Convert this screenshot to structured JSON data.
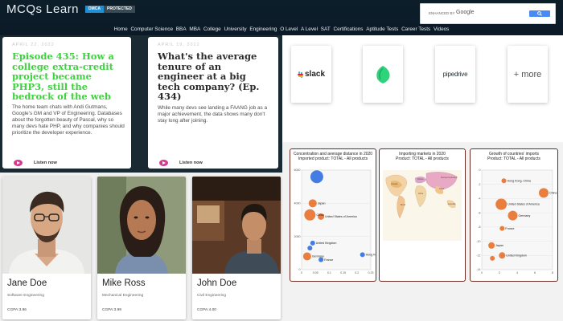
{
  "header": {
    "logo": "MCQs Learn",
    "dmca_label": "DMCA",
    "protected_label": "PROTECTED",
    "search_label": "ENHANCED BY",
    "search_brand": "Google",
    "nav": [
      "Home",
      "Computer Science",
      "BBA",
      "MBA",
      "College",
      "University",
      "Engineering",
      "O Level",
      "A Level",
      "SAT",
      "Certifications",
      "Aptitude Tests",
      "Career Tests",
      "Videos"
    ]
  },
  "podcast": {
    "episodes": [
      {
        "date": "APRIL 22, 2022",
        "title": "Episode 435: How a college extra-credit project became PHP3, still the bedrock of the web",
        "description": "The home team chats with Andi Gutmans, Google's GM and VP of Engineering. Databases about the forgotten beauty of Pascal, why so many devs hate PHP, and why companies should prioritize the developer experience.",
        "listen": "Listen now",
        "accent": "#3fd23f"
      },
      {
        "date": "APRIL 19, 2022",
        "title": "What's the average tenure of an engineer at a big tech company? (Ep. 434)",
        "description": "While many devs see landing a FAANG job as a major achievement, the data shows many don't stay long after joining.",
        "listen": "Listen now",
        "accent": "#2b2b2b"
      }
    ]
  },
  "integrations": {
    "slack": "slack",
    "pipedrive": "pipedrive",
    "more": "+ more"
  },
  "profiles": [
    {
      "name": "Jane Doe",
      "role": "Software Engineering",
      "cgpa": "CGPA:3.86"
    },
    {
      "name": "Mike Ross",
      "role": "Mechanical Engineering",
      "cgpa": "CGPA:3.99"
    },
    {
      "name": "John Doe",
      "role": "Civil Engineering",
      "cgpa": "CGPA:4.00"
    }
  ],
  "chart_data": [
    {
      "type": "scatter",
      "title": "Concentration and average distance in 2020",
      "subtitle": "Imported product: TOTAL - All products",
      "xlim": [
        0,
        0.25
      ],
      "ylim": [
        0,
        6000
      ],
      "xticks": [
        "0",
        "0.05",
        "0.1",
        "0.15",
        "0.2",
        "0.25"
      ],
      "yticks": [
        "0",
        "2000",
        "4000",
        "6000"
      ],
      "points": [
        {
          "name": "",
          "x": 0.055,
          "y": 5600,
          "size": 8,
          "color": "#2f6fe0"
        },
        {
          "name": "Japan",
          "x": 0.04,
          "y": 4000,
          "size": 5,
          "color": "#e8702a"
        },
        {
          "name": "United States of America",
          "x": 0.07,
          "y": 3200,
          "size": 4,
          "color": "#e8702a"
        },
        {
          "name": "China",
          "x": 0.03,
          "y": 3300,
          "size": 7,
          "color": "#e8702a"
        },
        {
          "name": "United Kingdom",
          "x": 0.04,
          "y": 1600,
          "size": 3,
          "color": "#2f6fe0"
        },
        {
          "name": "Germany",
          "x": 0.02,
          "y": 800,
          "size": 5,
          "color": "#e8702a"
        },
        {
          "name": "",
          "x": 0.03,
          "y": 1300,
          "size": 3,
          "color": "#2f6fe0"
        },
        {
          "name": "Hong Kong, China",
          "x": 0.22,
          "y": 900,
          "size": 3,
          "color": "#2f6fe0"
        },
        {
          "name": "France",
          "x": 0.07,
          "y": 600,
          "size": 3,
          "color": "#2f6fe0"
        }
      ]
    },
    {
      "type": "map",
      "title": "Importing markets in 2020",
      "subtitle": "Product: TOTAL - All products"
    },
    {
      "type": "scatter",
      "title": "Growth of countries' imports",
      "subtitle": "Product: TOTAL - All products",
      "xlim": [
        0,
        8
      ],
      "ylim": [
        -14,
        0
      ],
      "xticks": [
        "0",
        "2",
        "4",
        "6",
        "8"
      ],
      "yticks": [
        "0",
        "-2",
        "-4",
        "-6",
        "-8",
        "-10",
        "-12",
        "-14"
      ],
      "points": [
        {
          "name": "Hong Kong, China",
          "x": 2.5,
          "y": -1.5,
          "size": 3,
          "color": "#e8702a"
        },
        {
          "name": "United States of America",
          "x": 2.2,
          "y": -4.8,
          "size": 7,
          "color": "#e8702a"
        },
        {
          "name": "Germany",
          "x": 3.5,
          "y": -6.4,
          "size": 6,
          "color": "#e8702a"
        },
        {
          "name": "China",
          "x": 7.0,
          "y": -3.2,
          "size": 6,
          "color": "#e8702a"
        },
        {
          "name": "France",
          "x": 2.3,
          "y": -8.2,
          "size": 3,
          "color": "#e8702a"
        },
        {
          "name": "Japan",
          "x": 1.1,
          "y": -10.6,
          "size": 4,
          "color": "#e8702a"
        },
        {
          "name": "United Kingdom",
          "x": 2.3,
          "y": -12.0,
          "size": 4,
          "color": "#e8702a"
        },
        {
          "name": "",
          "x": 1.2,
          "y": -12.4,
          "size": 3,
          "color": "#e8702a"
        }
      ]
    }
  ]
}
